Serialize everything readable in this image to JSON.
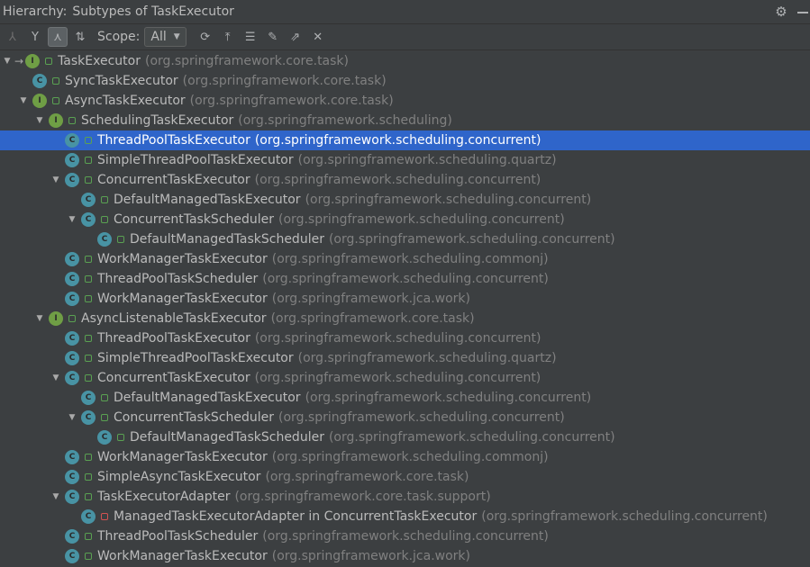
{
  "title": {
    "label": "Hierarchy:",
    "text": "Subtypes of TaskExecutor"
  },
  "toolbar": {
    "scope_label": "Scope:",
    "scope_value": "All",
    "buttons": [
      "supertypes-hierarchy",
      "subtypes-hierarchy",
      "type-hierarchy",
      "sort-alphabetically",
      "refresh",
      "scroll-to-source",
      "expand-all",
      "pin",
      "export",
      "close"
    ]
  },
  "tree": [
    {
      "name": "TaskExecutor",
      "pkg": "(org.springframework.core.task)",
      "depth": 0,
      "kind": "interface",
      "toggle": "expanded",
      "marker": true
    },
    {
      "name": "SyncTaskExecutor",
      "pkg": "(org.springframework.core.task)",
      "depth": 1,
      "kind": "class",
      "toggle": "none"
    },
    {
      "name": "AsyncTaskExecutor",
      "pkg": "(org.springframework.core.task)",
      "depth": 1,
      "kind": "interface",
      "toggle": "expanded"
    },
    {
      "name": "SchedulingTaskExecutor",
      "pkg": "(org.springframework.scheduling)",
      "depth": 2,
      "kind": "interface",
      "toggle": "expanded"
    },
    {
      "name": "ThreadPoolTaskExecutor",
      "pkg": "(org.springframework.scheduling.concurrent)",
      "depth": 3,
      "kind": "class",
      "toggle": "none",
      "selected": true
    },
    {
      "name": "SimpleThreadPoolTaskExecutor",
      "pkg": "(org.springframework.scheduling.quartz)",
      "depth": 3,
      "kind": "class",
      "toggle": "none"
    },
    {
      "name": "ConcurrentTaskExecutor",
      "pkg": "(org.springframework.scheduling.concurrent)",
      "depth": 3,
      "kind": "class",
      "toggle": "expanded"
    },
    {
      "name": "DefaultManagedTaskExecutor",
      "pkg": "(org.springframework.scheduling.concurrent)",
      "depth": 4,
      "kind": "class",
      "toggle": "none"
    },
    {
      "name": "ConcurrentTaskScheduler",
      "pkg": "(org.springframework.scheduling.concurrent)",
      "depth": 4,
      "kind": "class",
      "toggle": "expanded"
    },
    {
      "name": "DefaultManagedTaskScheduler",
      "pkg": "(org.springframework.scheduling.concurrent)",
      "depth": 5,
      "kind": "class",
      "toggle": "none"
    },
    {
      "name": "WorkManagerTaskExecutor",
      "pkg": "(org.springframework.scheduling.commonj)",
      "depth": 3,
      "kind": "class",
      "toggle": "none"
    },
    {
      "name": "ThreadPoolTaskScheduler",
      "pkg": "(org.springframework.scheduling.concurrent)",
      "depth": 3,
      "kind": "class",
      "toggle": "none"
    },
    {
      "name": "WorkManagerTaskExecutor",
      "pkg": "(org.springframework.jca.work)",
      "depth": 3,
      "kind": "class",
      "toggle": "none"
    },
    {
      "name": "AsyncListenableTaskExecutor",
      "pkg": "(org.springframework.core.task)",
      "depth": 2,
      "kind": "interface",
      "toggle": "expanded"
    },
    {
      "name": "ThreadPoolTaskExecutor",
      "pkg": "(org.springframework.scheduling.concurrent)",
      "depth": 3,
      "kind": "class",
      "toggle": "none"
    },
    {
      "name": "SimpleThreadPoolTaskExecutor",
      "pkg": "(org.springframework.scheduling.quartz)",
      "depth": 3,
      "kind": "class",
      "toggle": "none"
    },
    {
      "name": "ConcurrentTaskExecutor",
      "pkg": "(org.springframework.scheduling.concurrent)",
      "depth": 3,
      "kind": "class",
      "toggle": "expanded"
    },
    {
      "name": "DefaultManagedTaskExecutor",
      "pkg": "(org.springframework.scheduling.concurrent)",
      "depth": 4,
      "kind": "class",
      "toggle": "none"
    },
    {
      "name": "ConcurrentTaskScheduler",
      "pkg": "(org.springframework.scheduling.concurrent)",
      "depth": 4,
      "kind": "class",
      "toggle": "expanded"
    },
    {
      "name": "DefaultManagedTaskScheduler",
      "pkg": "(org.springframework.scheduling.concurrent)",
      "depth": 5,
      "kind": "class",
      "toggle": "none"
    },
    {
      "name": "WorkManagerTaskExecutor",
      "pkg": "(org.springframework.scheduling.commonj)",
      "depth": 3,
      "kind": "class",
      "toggle": "none"
    },
    {
      "name": "SimpleAsyncTaskExecutor",
      "pkg": "(org.springframework.core.task)",
      "depth": 3,
      "kind": "class",
      "toggle": "none"
    },
    {
      "name": "TaskExecutorAdapter",
      "pkg": "(org.springframework.core.task.support)",
      "depth": 3,
      "kind": "class",
      "toggle": "expanded"
    },
    {
      "name": "ManagedTaskExecutorAdapter in ConcurrentTaskExecutor",
      "pkg": "(org.springframework.scheduling.concurrent)",
      "depth": 4,
      "kind": "class",
      "toggle": "none",
      "private": true
    },
    {
      "name": "ThreadPoolTaskScheduler",
      "pkg": "(org.springframework.scheduling.concurrent)",
      "depth": 3,
      "kind": "class",
      "toggle": "none"
    },
    {
      "name": "WorkManagerTaskExecutor",
      "pkg": "(org.springframework.jca.work)",
      "depth": 3,
      "kind": "class",
      "toggle": "none"
    }
  ],
  "icons": {
    "class_letter": "C",
    "interface_letter": "I"
  },
  "colors": {
    "background": "#3c3f41",
    "selection": "#2f65ca",
    "class_icon": "#4893a4",
    "interface_icon": "#6f9e45",
    "package_text": "#808080"
  }
}
